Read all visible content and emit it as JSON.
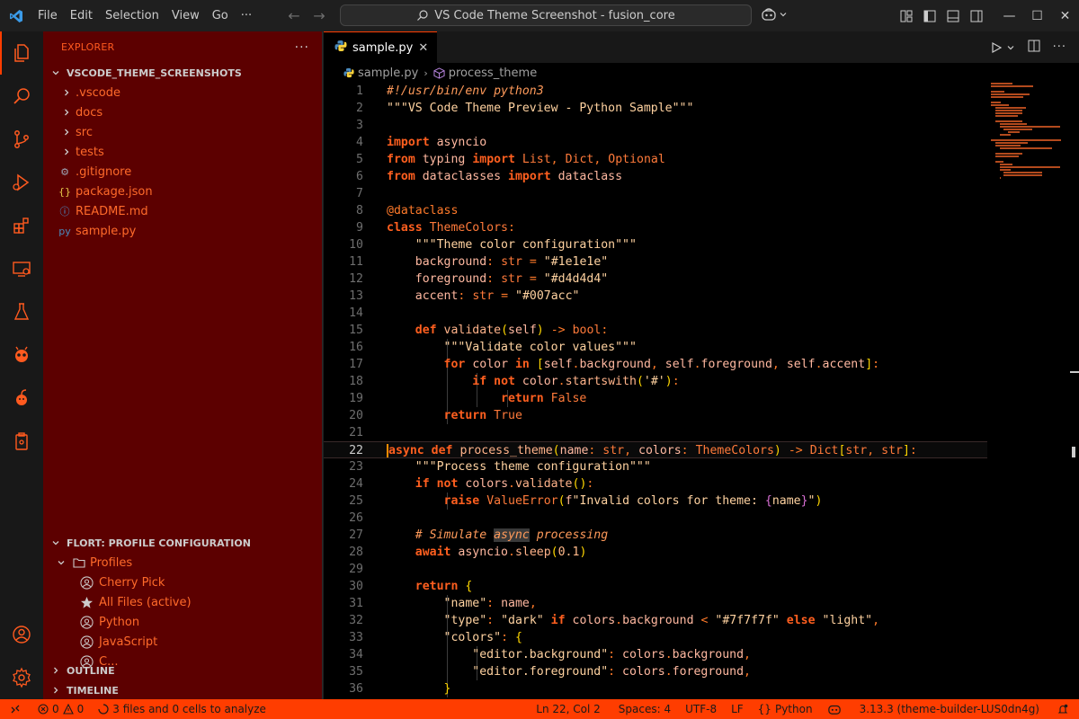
{
  "titlebar": {
    "menu": [
      "File",
      "Edit",
      "Selection",
      "View",
      "Go",
      "···"
    ],
    "search": "VS Code Theme Screenshot - fusion_core"
  },
  "explorer": {
    "title": "EXPLORER",
    "more": "···",
    "root": "VSCODE_THEME_SCREENSHOTS",
    "folders": [
      ".vscode",
      "docs",
      "src",
      "tests"
    ],
    "files": [
      {
        "name": ".gitignore",
        "icon": "⚙"
      },
      {
        "name": "package.json",
        "icon": "{}"
      },
      {
        "name": "README.md",
        "icon": "ⓘ"
      },
      {
        "name": "sample.py",
        "icon": "py"
      }
    ]
  },
  "profiles": {
    "section_title": "FLORT: PROFILE CONFIGURATION",
    "group": "Profiles",
    "items": [
      "Cherry Pick",
      "All Files (active)",
      "Python",
      "JavaScript",
      "C..."
    ]
  },
  "bottom_sections": [
    "OUTLINE",
    "TIMELINE"
  ],
  "editor": {
    "tab": "sample.py",
    "breadcrumb_file": "sample.py",
    "breadcrumb_symbol": "process_theme"
  },
  "status": {
    "errors": "0",
    "warnings": "0",
    "analysis": "3 files and 0 cells to analyze",
    "position": "Ln 22, Col 2",
    "spaces": "Spaces: 4",
    "encoding": "UTF-8",
    "eol": "LF",
    "language": "Python",
    "interpreter": "3.13.3 (theme-builder-LUS0dn4g)"
  },
  "colors": {
    "accent": "#ff3d00",
    "sidebar_bg": "#5c0000",
    "editor_bg": "#000000",
    "text_orange": "#ff6a2a"
  },
  "code_lines": [
    "#!/usr/bin/env python3",
    "\"\"\"VS Code Theme Preview - Python Sample\"\"\"",
    "",
    "import asyncio",
    "from typing import List, Dict, Optional",
    "from dataclasses import dataclass",
    "",
    "@dataclass",
    "class ThemeColors:",
    "    \"\"\"Theme color configuration\"\"\"",
    "    background: str = \"#1e1e1e\"",
    "    foreground: str = \"#d4d4d4\"",
    "    accent: str = \"#007acc\"",
    "",
    "    def validate(self) -> bool:",
    "        \"\"\"Validate color values\"\"\"",
    "        for color in [self.background, self.foreground, self.accent]:",
    "            if not color.startswith('#'):",
    "                return False",
    "        return True",
    "",
    "async def process_theme(name: str, colors: ThemeColors) -> Dict[str, str]:",
    "    \"\"\"Process theme configuration\"\"\"",
    "    if not colors.validate():",
    "        raise ValueError(f\"Invalid colors for theme: {name}\")",
    "",
    "    # Simulate async processing",
    "    await asyncio.sleep(0.1)",
    "",
    "    return {",
    "        \"name\": name,",
    "        \"type\": \"dark\" if colors.background < \"#7f7f7f\" else \"light\",",
    "        \"colors\": {",
    "            \"editor.background\": colors.background,",
    "            \"editor.foreground\": colors.foreground,",
    "        }"
  ]
}
